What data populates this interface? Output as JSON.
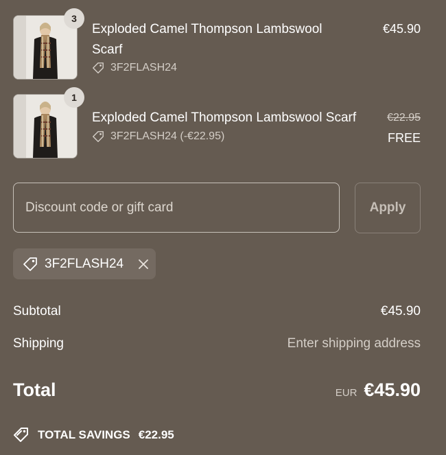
{
  "line_items": [
    {
      "quantity": "3",
      "name_line1": "Exploded Camel Thompson Lambswool",
      "name_line2": "Scarf",
      "discount_label": "3F2FLASH24",
      "price": "€45.90"
    },
    {
      "quantity": "1",
      "name": "Exploded Camel Thompson Lambswool Scarf",
      "discount_label": "3F2FLASH24 (-€22.95)",
      "original_price": "€22.95",
      "price": "FREE"
    }
  ],
  "discount": {
    "placeholder": "Discount code or gift card",
    "apply_label": "Apply",
    "applied_code": "3F2FLASH24"
  },
  "summary": {
    "subtotal_label": "Subtotal",
    "subtotal_value": "€45.90",
    "shipping_label": "Shipping",
    "shipping_value": "Enter shipping address",
    "total_label": "Total",
    "currency": "EUR",
    "total_value": "€45.90",
    "savings_label": "TOTAL SAVINGS",
    "savings_value": "€22.95"
  },
  "colors": {
    "background": "#655b51",
    "text": "#ffffff",
    "muted_text": "#d4cec7"
  }
}
